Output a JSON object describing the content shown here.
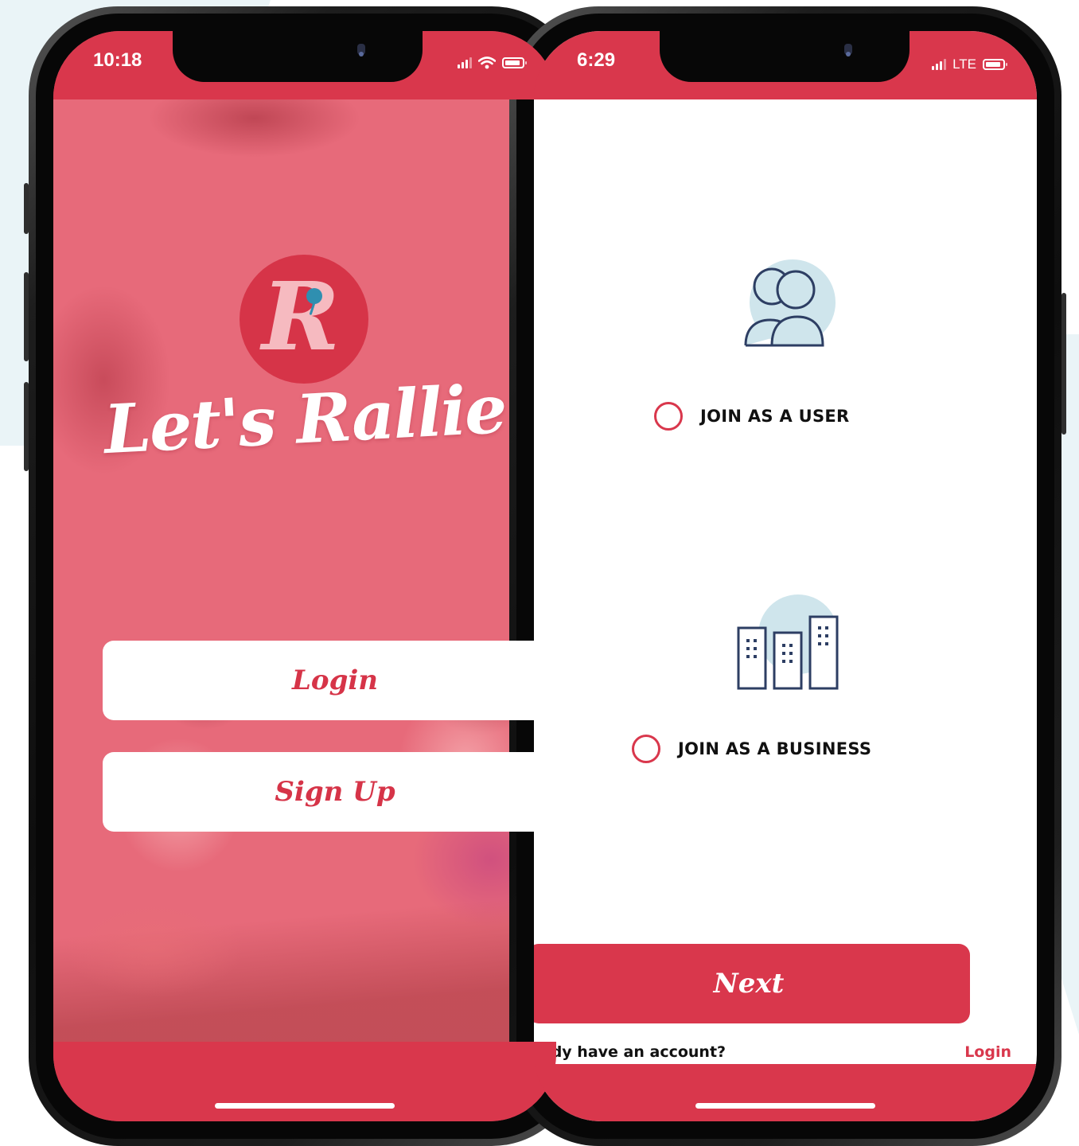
{
  "phone_welcome": {
    "status_time": "10:18",
    "logo_letter": "R",
    "brand_name": "Let's Rallie",
    "login_label": "Login",
    "signup_label": "Sign Up"
  },
  "phone_join": {
    "status_time": "6:29",
    "network_label": "LTE",
    "options": [
      {
        "label": "JOIN AS A USER",
        "icon": "users-icon",
        "selected": false
      },
      {
        "label": "JOIN AS A BUSINESS",
        "icon": "buildings-icon",
        "selected": false
      }
    ],
    "next_label": "Next",
    "account_prompt": "eady have an account?",
    "account_login_label": "Login"
  },
  "colors": {
    "brand_red": "#d9374c",
    "overlay_pink": "#e76a7a",
    "logo_pink": "#f6bac0",
    "icon_navy": "#2d3e63",
    "icon_blue_fill": "#cfe5ec",
    "background_tint": "#eaf4f7"
  }
}
